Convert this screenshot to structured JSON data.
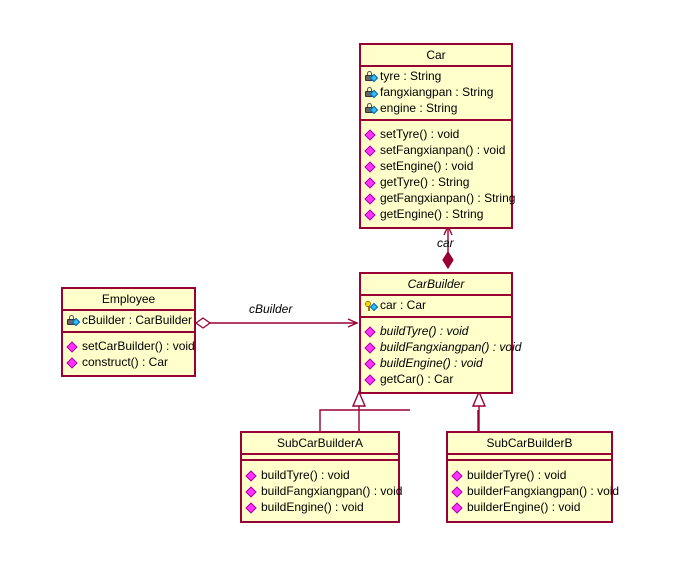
{
  "diagram": {
    "title": "Builder pattern UML class diagram",
    "background_color": "#ffffff",
    "class_border_color": "#990033",
    "class_fill_color": "#ffffcc",
    "edge_color": "#990033"
  },
  "classes": {
    "car": {
      "name": "Car",
      "abstract": false,
      "attributes": [
        {
          "icon": "private-lock-icon",
          "text": "tyre : String"
        },
        {
          "icon": "private-lock-icon",
          "text": "fangxiangpan : String"
        },
        {
          "icon": "private-lock-icon",
          "text": "engine : String"
        }
      ],
      "methods": [
        {
          "icon": "public-method-icon",
          "text": "setTyre() : void"
        },
        {
          "icon": "public-method-icon",
          "text": "setFangxianpan() : void"
        },
        {
          "icon": "public-method-icon",
          "text": "setEngine() : void"
        },
        {
          "icon": "public-method-icon",
          "text": "getTyre() : String"
        },
        {
          "icon": "public-method-icon",
          "text": "getFangxianpan() : String"
        },
        {
          "icon": "public-method-icon",
          "text": "getEngine() : String"
        }
      ]
    },
    "car_builder": {
      "name": "CarBuilder",
      "abstract": true,
      "attributes": [
        {
          "icon": "protected-key-icon",
          "text": "car : Car"
        }
      ],
      "methods": [
        {
          "icon": "public-method-icon",
          "text": "buildTyre() : void",
          "abstract": true
        },
        {
          "icon": "public-method-icon",
          "text": "buildFangxiangpan() : void",
          "abstract": true
        },
        {
          "icon": "public-method-icon",
          "text": "buildEngine() : void",
          "abstract": true
        },
        {
          "icon": "public-method-icon",
          "text": "getCar() : Car",
          "abstract": false
        }
      ]
    },
    "employee": {
      "name": "Employee",
      "abstract": false,
      "attributes": [
        {
          "icon": "private-lock-icon",
          "text": "cBuilder : CarBuilder"
        }
      ],
      "methods": [
        {
          "icon": "public-method-icon",
          "text": "setCarBuilder() : void"
        },
        {
          "icon": "public-method-icon",
          "text": "construct() : Car"
        }
      ]
    },
    "sub_car_builder_a": {
      "name": "SubCarBuilderA",
      "abstract": false,
      "attributes": [],
      "methods": [
        {
          "icon": "public-method-icon",
          "text": "buildTyre() : void"
        },
        {
          "icon": "public-method-icon",
          "text": "buildFangxiangpan() : void"
        },
        {
          "icon": "public-method-icon",
          "text": "buildEngine() : void"
        }
      ]
    },
    "sub_car_builder_b": {
      "name": "SubCarBuilderB",
      "abstract": false,
      "attributes": [],
      "methods": [
        {
          "icon": "public-method-icon",
          "text": "builderTyre() : void"
        },
        {
          "icon": "public-method-icon",
          "text": "builderFangxiangpan() : void"
        },
        {
          "icon": "public-method-icon",
          "text": "builderEngine() : void"
        }
      ]
    }
  },
  "relationships": {
    "composition_car": {
      "label": "car",
      "type": "composition",
      "from": "CarBuilder",
      "to": "Car"
    },
    "aggregation_cbuilder": {
      "label": "cBuilder",
      "type": "aggregation",
      "from": "Employee",
      "to": "CarBuilder"
    },
    "inheritance_a": {
      "label": "",
      "type": "generalization",
      "from": "SubCarBuilderA",
      "to": "CarBuilder"
    },
    "inheritance_b": {
      "label": "",
      "type": "generalization",
      "from": "SubCarBuilderB",
      "to": "CarBuilder"
    }
  }
}
